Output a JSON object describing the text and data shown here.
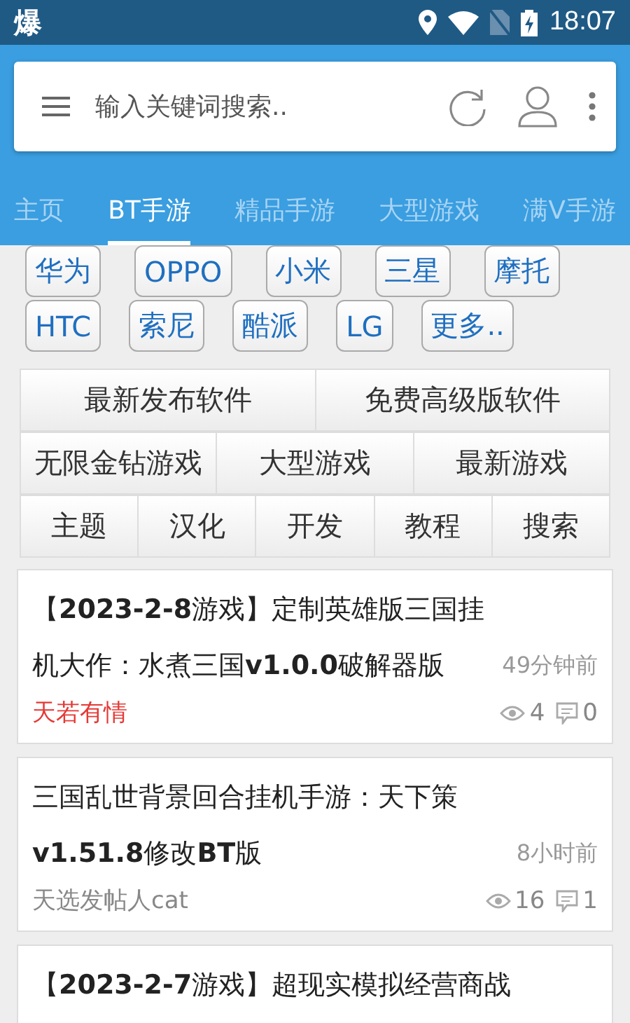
{
  "status_bar": {
    "app_glyph": "爆",
    "time": "18:07"
  },
  "search": {
    "placeholder": "输入关键词搜索.."
  },
  "tabs": [
    {
      "label": "主页",
      "selected": false
    },
    {
      "label": "BT手游",
      "selected": true
    },
    {
      "label": "精品手游",
      "selected": false
    },
    {
      "label": "大型游戏",
      "selected": false
    },
    {
      "label": "满V手游",
      "selected": false
    }
  ],
  "brands": [
    [
      "华为",
      "OPPO",
      "小米",
      "三星",
      "摩托"
    ],
    [
      "HTC",
      "索尼",
      "酷派",
      "LG",
      "更多.."
    ]
  ],
  "categories": [
    [
      "最新发布软件",
      "免费高级版软件"
    ],
    [
      "无限金钻游戏",
      "大型游戏",
      "最新游戏"
    ],
    [
      "主题",
      "汉化",
      "开发",
      "教程",
      "搜索"
    ]
  ],
  "posts": [
    {
      "title": "【**2023-2-8**游戏】定制英雄版三国挂机大作：水煮三国**v1.0.0**破解器版",
      "time": "49分钟前",
      "author": "天若有情",
      "author_highlighted": true,
      "views": "4",
      "comments": "0"
    },
    {
      "title": "三国乱世背景回合挂机手游：天下策**v1.51.8**修改**BT**版",
      "time": "8小时前",
      "author": "天选发帖人cat",
      "author_highlighted": false,
      "views": "16",
      "comments": "1"
    },
    {
      "title": "【**2023-2-7**游戏】超现实模拟经营商战"
    }
  ]
}
